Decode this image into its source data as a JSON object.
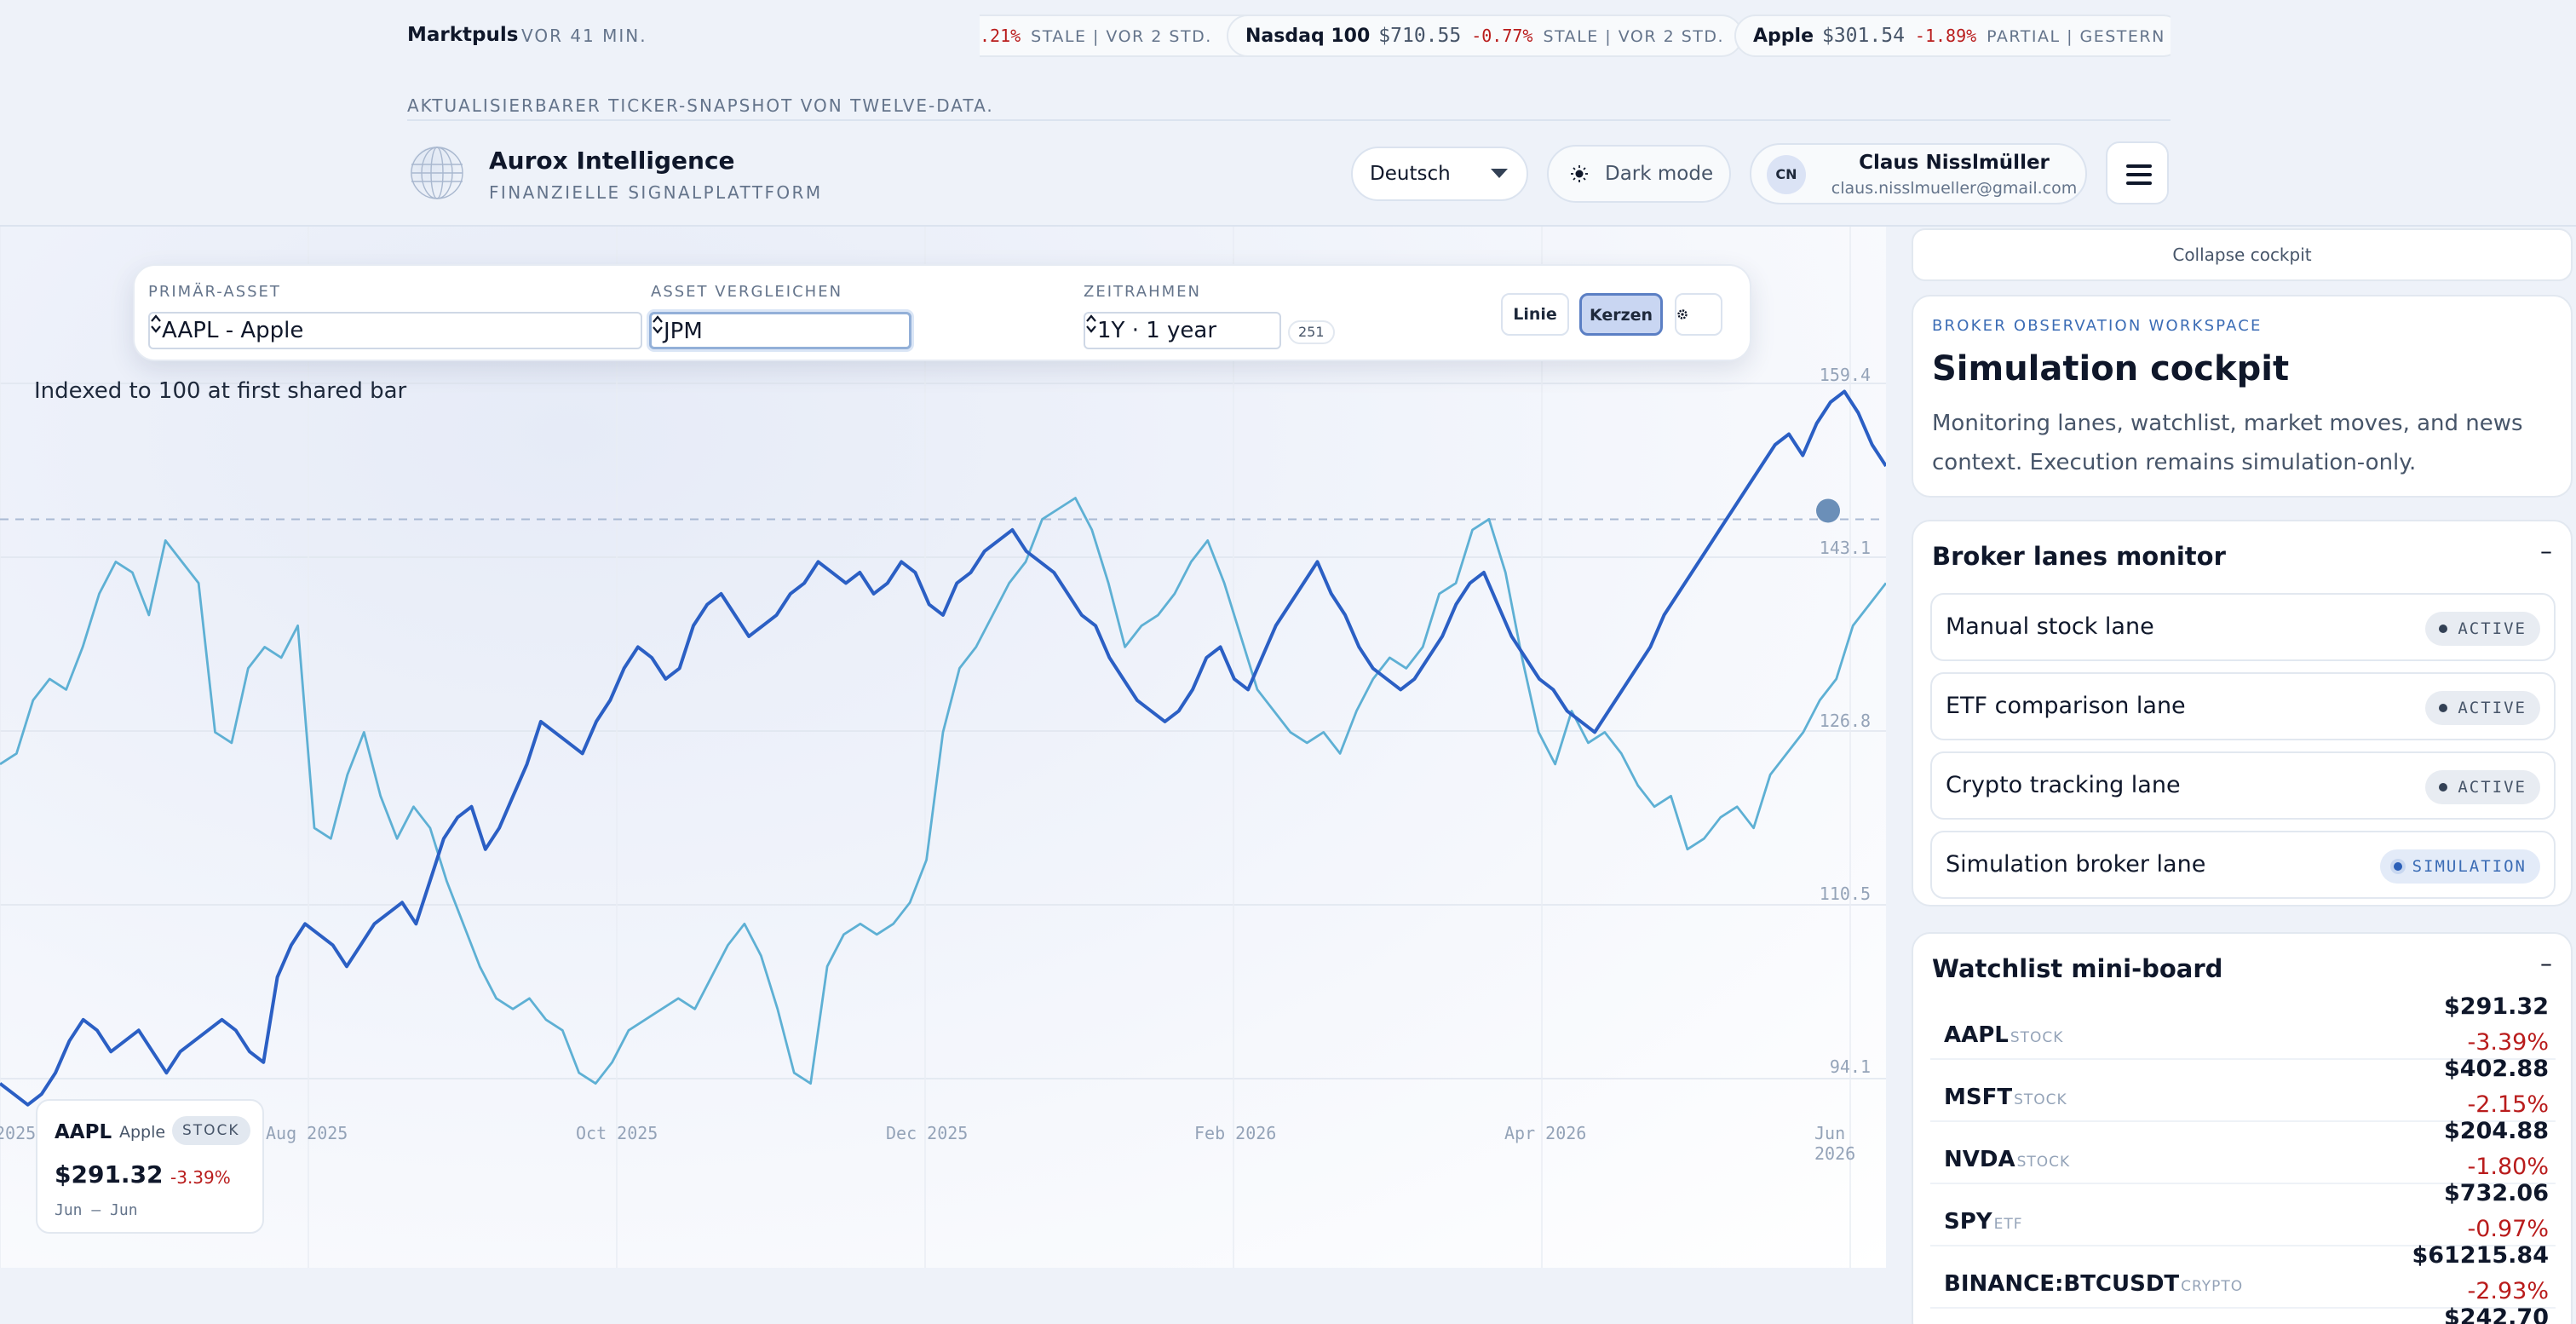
{
  "ticker": {
    "label": "Marktpuls",
    "age": "VOR 41 MIN.",
    "items": [
      {
        "name": "",
        "price": "",
        "change": ".21%",
        "status": "STALE | VOR 2 STD."
      },
      {
        "name": "Nasdaq 100",
        "price": "$710.55",
        "change": "-0.77%",
        "status": "STALE | VOR 2 STD."
      },
      {
        "name": "Apple",
        "price": "$301.54",
        "change": "-1.89%",
        "status": "PARTIAL | GESTERN"
      }
    ]
  },
  "subcaption": "AKTUALISIERBARER TICKER-SNAPSHOT VON TWELVE-DATA.",
  "brand": {
    "name": "Aurox Intelligence",
    "subtitle": "FINANZIELLE SIGNALPLATTFORM"
  },
  "header": {
    "language": "Deutsch",
    "dark_mode_label": "Dark mode",
    "user": {
      "initials": "CN",
      "name": "Claus Nisslmüller",
      "email": "claus.nisslmueller@gmail.com"
    }
  },
  "controls": {
    "primary_label": "PRIMÄR-ASSET",
    "primary_value": "AAPL - Apple",
    "compare_label": "ASSET VERGLEICHEN",
    "compare_value": "JPM",
    "timeframe_label": "ZEITRAHMEN",
    "timeframe_value": "1Y · 1 year",
    "bar_count": "251",
    "line_label": "Linie",
    "candles_label": "Kerzen",
    "settings_icon": "gear-icon"
  },
  "chart_caption": "Indexed to 100 at first shared bar",
  "chart_data": {
    "type": "line",
    "y_ticks": [
      "159.4",
      "143.1",
      "126.8",
      "110.5",
      "94.1"
    ],
    "ylim": [
      94.1,
      159.4
    ],
    "x_ticks": [
      "2025",
      "Aug 2025",
      "Oct 2025",
      "Dec 2025",
      "Feb 2026",
      "Apr 2026",
      "Jun 2026"
    ],
    "reference_line": 146,
    "series": [
      {
        "name": "AAPL",
        "color": "#2b5fc4",
        "values": [
          93,
          92,
          91,
          92,
          94,
          97,
          99,
          98,
          96,
          97,
          98,
          96,
          94,
          96,
          97,
          98,
          99,
          98,
          96,
          95,
          103,
          106,
          108,
          107,
          106,
          104,
          106,
          108,
          109,
          110,
          108,
          112,
          116,
          118,
          119,
          115,
          117,
          120,
          123,
          127,
          126,
          125,
          124,
          127,
          129,
          132,
          134,
          133,
          131,
          132,
          136,
          138,
          139,
          137,
          135,
          136,
          137,
          139,
          140,
          142,
          141,
          140,
          141,
          139,
          140,
          142,
          141,
          138,
          137,
          140,
          141,
          143,
          144,
          145,
          143,
          142,
          141,
          139,
          137,
          136,
          133,
          131,
          129,
          128,
          127,
          128,
          130,
          133,
          134,
          131,
          130,
          133,
          136,
          138,
          140,
          142,
          139,
          137,
          134,
          132,
          131,
          130,
          131,
          133,
          135,
          138,
          140,
          141,
          138,
          135,
          133,
          131,
          130,
          128,
          127,
          126,
          128,
          130,
          132,
          134,
          137,
          139,
          141,
          143,
          145,
          147,
          149,
          151,
          153,
          154,
          152,
          155,
          157,
          158,
          156,
          153,
          151
        ]
      },
      {
        "name": "JPM",
        "color": "#5eb0d4",
        "values": [
          123,
          124,
          129,
          131,
          130,
          134,
          139,
          142,
          141,
          137,
          144,
          142,
          140,
          126,
          125,
          132,
          134,
          133,
          136,
          117,
          116,
          122,
          126,
          120,
          116,
          119,
          117,
          112,
          108,
          104,
          101,
          100,
          101,
          99,
          98,
          94,
          93,
          95,
          98,
          99,
          100,
          101,
          100,
          103,
          106,
          108,
          105,
          100,
          94,
          93,
          104,
          107,
          108,
          107,
          108,
          110,
          114,
          126,
          132,
          134,
          137,
          140,
          142,
          146,
          147,
          148,
          145,
          140,
          134,
          136,
          137,
          139,
          142,
          144,
          140,
          135,
          130,
          128,
          126,
          125,
          126,
          124,
          128,
          131,
          133,
          132,
          134,
          139,
          140,
          145,
          146,
          141,
          133,
          126,
          123,
          128,
          125,
          126,
          124,
          121,
          119,
          120,
          115,
          116,
          118,
          119,
          117,
          122,
          124,
          126,
          129,
          131,
          136,
          138,
          140
        ]
      }
    ]
  },
  "hover_card": {
    "symbol": "AAPL",
    "name": "Apple",
    "type": "STOCK",
    "price": "$291.32",
    "change": "-3.39%",
    "range": "Jun – Jun"
  },
  "panel": {
    "collapse_label": "Collapse cockpit",
    "eyebrow": "BROKER OBSERVATION WORKSPACE",
    "title": "Simulation cockpit",
    "description": "Monitoring lanes, watchlist, market moves, and news context. Execution remains simulation-only.",
    "lanes_title": "Broker lanes monitor",
    "lanes_toggle": "–",
    "lanes": [
      {
        "name": "Manual stock lane",
        "status": "ACTIVE"
      },
      {
        "name": "ETF comparison lane",
        "status": "ACTIVE"
      },
      {
        "name": "Crypto tracking lane",
        "status": "ACTIVE"
      },
      {
        "name": "Simulation broker lane",
        "status": "SIMULATION"
      }
    ],
    "watchlist_title": "Watchlist mini-board",
    "watchlist_toggle": "–",
    "watchlist": [
      {
        "symbol": "AAPL",
        "type": "STOCK",
        "price": "$291.32",
        "change": "-3.39%"
      },
      {
        "symbol": "MSFT",
        "type": "STOCK",
        "price": "$402.88",
        "change": "-2.15%"
      },
      {
        "symbol": "NVDA",
        "type": "STOCK",
        "price": "$204.88",
        "change": "-1.80%"
      },
      {
        "symbol": "SPY",
        "type": "ETF",
        "price": "$732.06",
        "change": "-0.97%"
      },
      {
        "symbol": "BINANCE:BTCUSDT",
        "type": "CRYPTO",
        "price": "$61215.84",
        "change": "-2.93%"
      },
      {
        "symbol": "",
        "type": "",
        "price": "$242.70",
        "change": ""
      }
    ]
  }
}
